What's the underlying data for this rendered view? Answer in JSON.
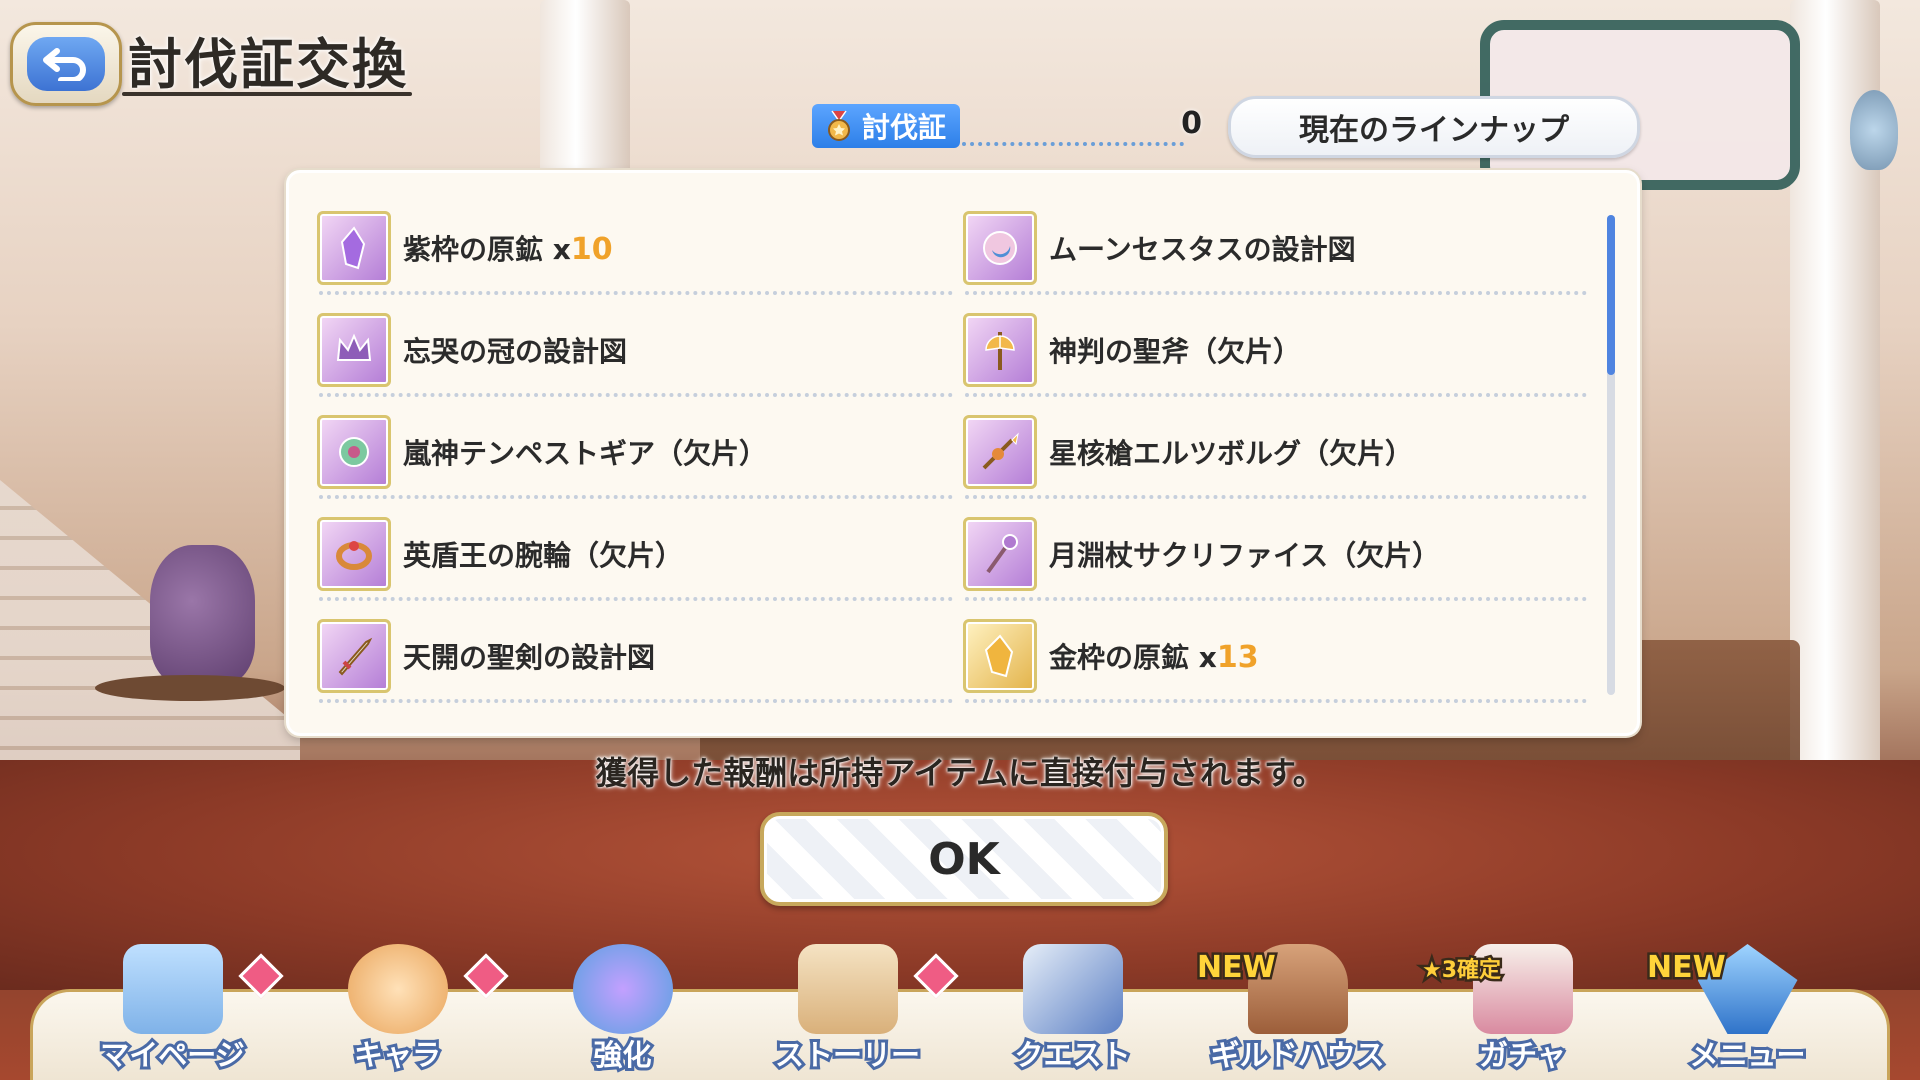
{
  "header": {
    "title": "討伐証交換",
    "back_icon": "back-arrow-icon"
  },
  "currency": {
    "label": "討伐証",
    "icon": "medal-icon",
    "count": "0"
  },
  "lineup_button": "現在のラインナップ",
  "items": [
    {
      "name": "紫枠の原鉱",
      "mult": " x",
      "qty": "10",
      "icon": "purple-ore-icon"
    },
    {
      "name": "ムーンセスタスの設計図",
      "icon": "moon-cestus-blueprint-icon"
    },
    {
      "name": "忘哭の冠の設計図",
      "icon": "crown-blueprint-icon"
    },
    {
      "name": "神判の聖斧（欠片）",
      "icon": "holy-axe-fragment-icon"
    },
    {
      "name": "嵐神テンペストギア（欠片）",
      "icon": "tempest-gear-fragment-icon"
    },
    {
      "name": "星核槍エルツボルグ（欠片）",
      "icon": "star-spear-fragment-icon"
    },
    {
      "name": "英盾王の腕輪（欠片）",
      "icon": "bracelet-fragment-icon"
    },
    {
      "name": "月淵杖サクリファイス（欠片）",
      "icon": "moon-staff-fragment-icon"
    },
    {
      "name": "天開の聖剣の設計図",
      "icon": "holy-sword-blueprint-icon"
    },
    {
      "name": "金枠の原鉱",
      "mult": " x",
      "qty": "13",
      "icon": "gold-ore-icon"
    }
  ],
  "notice": "獲得した報酬は所持アイテムに直接付与されます。",
  "ok_button": "OK",
  "nav": [
    {
      "label": "マイページ",
      "icon": "castle-icon",
      "badge": true
    },
    {
      "label": "キャラ",
      "icon": "character-icon",
      "badge": true
    },
    {
      "label": "強化",
      "icon": "enhance-icon"
    },
    {
      "label": "ストーリー",
      "icon": "scroll-icon",
      "badge": true
    },
    {
      "label": "クエスト",
      "icon": "quest-flag-icon"
    },
    {
      "label": "ギルドハウス",
      "icon": "guild-door-icon",
      "new": "NEW"
    },
    {
      "label": "ガチャ",
      "icon": "gacha-icon",
      "tag": "★3確定"
    },
    {
      "label": "メニュー",
      "icon": "crystal-menu-icon",
      "new": "NEW"
    }
  ],
  "colors": {
    "accent_blue": "#2d7fe8",
    "qty_orange": "#f0a22a",
    "badge_pink": "#ef5c84",
    "gold_border": "#c7a85c"
  }
}
